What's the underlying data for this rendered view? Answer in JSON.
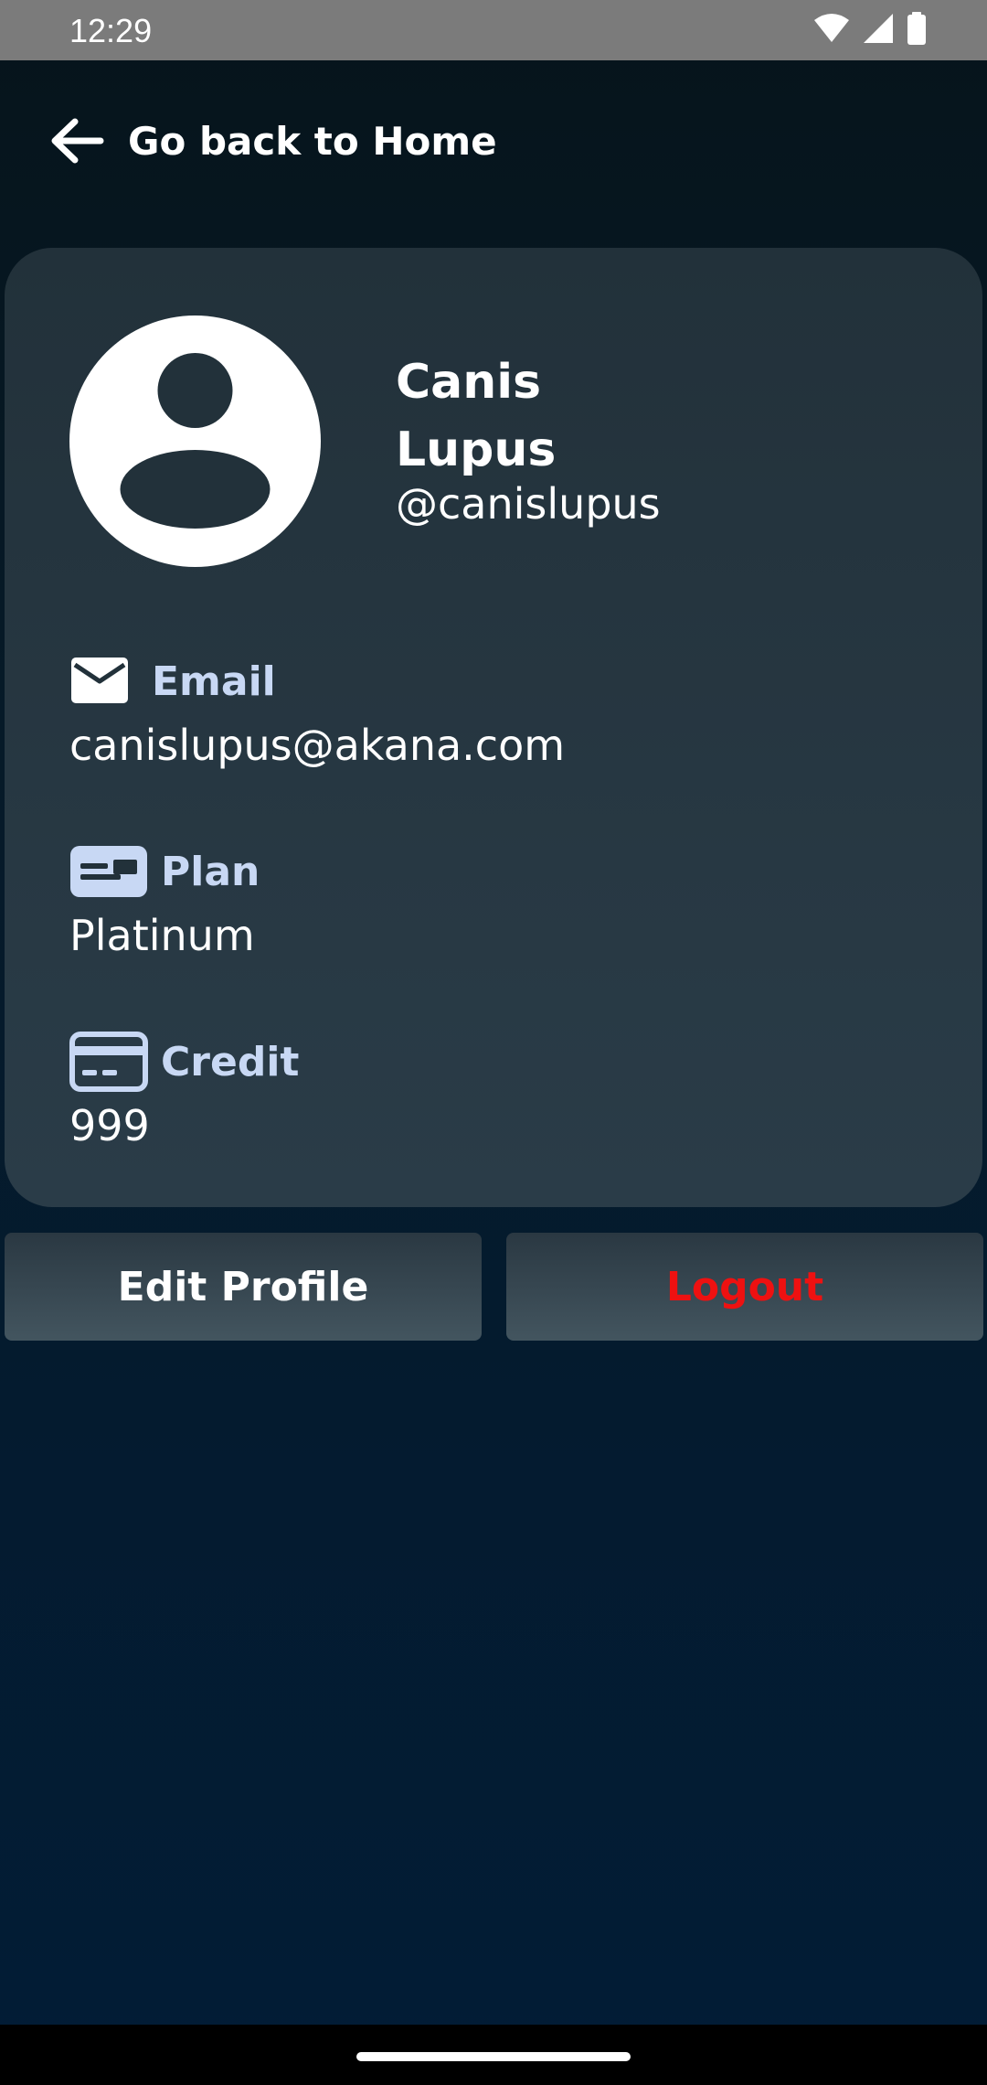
{
  "status_bar": {
    "time": "12:29",
    "icons": [
      "wifi-icon",
      "cellular-signal-icon",
      "battery-icon"
    ]
  },
  "header": {
    "back_label": "Go back to Home",
    "back_icon": "arrow-left-icon"
  },
  "profile": {
    "first_name": "Canis",
    "last_name": "Lupus",
    "handle": "@canislupus",
    "avatar_icon": "user-avatar-icon"
  },
  "fields": [
    {
      "icon": "mail-icon",
      "label": "Email",
      "value": "canislupus@akana.com"
    },
    {
      "icon": "id-card-icon",
      "label": "Plan",
      "value": "Platinum"
    },
    {
      "icon": "credit-card-icon",
      "label": "Credit",
      "value": "999"
    }
  ],
  "actions": {
    "edit_label": "Edit Profile",
    "logout_label": "Logout"
  },
  "colors": {
    "card_background": "#263640",
    "field_label": "#c8d8f4",
    "logout_text": "#ee1111",
    "status_bar": "#7b7b7b"
  }
}
